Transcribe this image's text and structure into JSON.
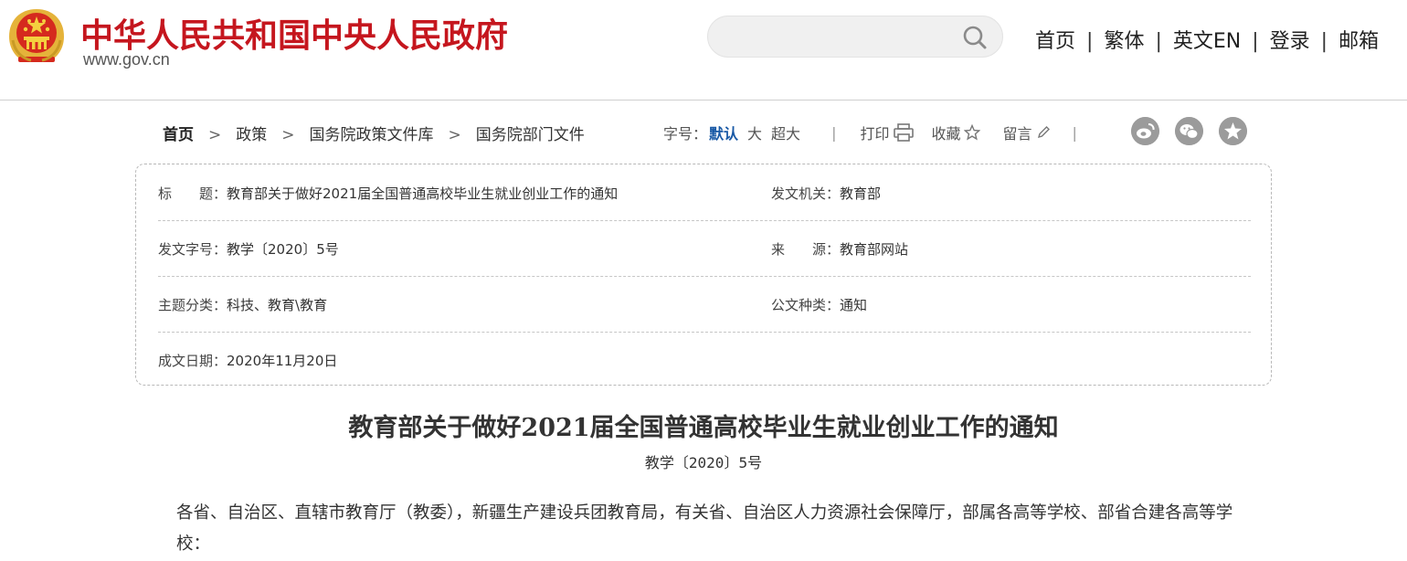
{
  "header": {
    "site_title": "中华人民共和国中央人民政府",
    "site_domain": "www.gov.cn",
    "search_placeholder": "",
    "nav": [
      "首页",
      "繁体",
      "英文EN",
      "登录",
      "邮箱"
    ]
  },
  "breadcrumb": [
    "首页",
    "政策",
    "国务院政策文件库",
    "国务院部门文件"
  ],
  "tools": {
    "font_size_label": "字号：",
    "font_default": "默认",
    "font_large": "大",
    "font_xlarge": "超大",
    "print": "打印",
    "favorite": "收藏",
    "comment": "留言"
  },
  "social": [
    "weibo-icon",
    "wechat-icon",
    "qzone-icon"
  ],
  "meta": {
    "title_label": "标　　题：",
    "title": "教育部关于做好2021届全国普通高校毕业生就业创业工作的通知",
    "issuer_label": "发文机关：",
    "issuer": "教育部",
    "doc_no_label": "发文字号：",
    "doc_no": "教学〔2020〕5号",
    "source_label": "来　　源：",
    "source": "教育部网站",
    "topic_label": "主题分类：",
    "topic": "科技、教育\\教育",
    "doc_type_label": "公文种类：",
    "doc_type": "通知",
    "date_label": "成文日期：",
    "date": "2020年11月20日"
  },
  "article": {
    "title": "教育部关于做好2021届全国普通高校毕业生就业创业工作的通知",
    "number": "教学〔2020〕5号",
    "salutation": "各省、自治区、直辖市教育厅（教委），新疆生产建设兵团教育局，有关省、自治区人力资源社会保障厅，部属各高等学校、部省合建各高等学校："
  },
  "colors": {
    "brand_red": "#c5161e",
    "link_blue": "#1a5aa6"
  }
}
